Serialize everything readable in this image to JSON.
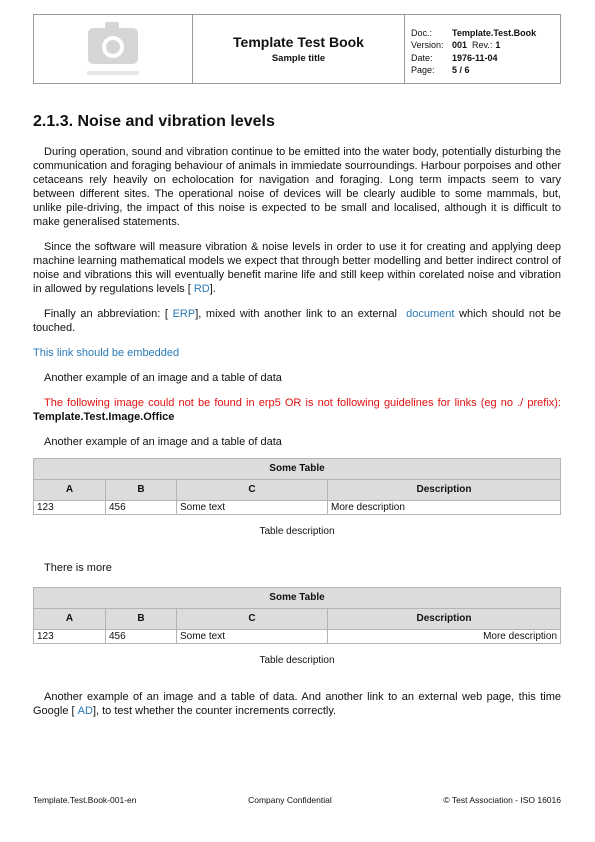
{
  "header": {
    "title": "Template Test Book",
    "subtitle": "Sample title",
    "meta": [
      {
        "key": "Doc.:",
        "value": "Template.Test.Book"
      },
      {
        "key": "Version:",
        "value": "001",
        "extra_key": "Rev.:",
        "extra_value": "1"
      },
      {
        "key": "Date:",
        "value": "1976-11-04"
      },
      {
        "key": "Page:",
        "value": "5 / 6"
      }
    ]
  },
  "heading": "2.1.3. Noise and vibration levels",
  "paragraphs": {
    "p1": "During operation, sound and vibration continue to be emitted into the water body, potentially disturbing the communication and foraging behaviour of animals in immiedate sourroundings. Harbour porpoises and other cetaceans rely heavily on echolocation for navigation and foraging. Long term impacts seem to vary between different sites. The operational noise of devices will be clearly audible to some mammals, but, unlike pile-driving, the impact of this noise is expected to be small and localised, although it is difficult to make generalised statements.",
    "p2": "Since the software will measure vibration & noise levels in order to use it for creating and applying deep machine learning mathematical models we expect that through better modelling and better indirect control of noise and vibrations this will eventually benefit marine life and still keep within corelated noise and vibration in allowed by regulations levels [",
    "p2_link": "RD",
    "p2_end": "].",
    "p3_a": "Finally an abbreviation: [",
    "p3_link1": "ERP",
    "p3_b": "], mixed with another link to an external",
    "p3_link2": "document",
    "p3_c": "which should not be touched.",
    "embedded_link": "This link should be embedded",
    "p4": "Another example of an image and a table of data",
    "error_text": "The following image could not be found in erp5 OR is not following guidelines for links (eg no ./ prefix):",
    "error_ref": "Template.Test.Image.Office",
    "p5": "Another example of an image and a table of data",
    "p6": "There is more",
    "p7_a": "Another example of an image and a table of data. And another link to an external web page, this time Google [",
    "p7_link": "AD",
    "p7_b": "], to test whether the counter increments correctly."
  },
  "table1": {
    "title": "Some Table",
    "columns": [
      "A",
      "B",
      "C",
      "Description"
    ],
    "rows": [
      [
        "123",
        "456",
        "Some text",
        "More description"
      ]
    ],
    "caption": "Table description"
  },
  "table2": {
    "title": "Some Table",
    "columns": [
      "A",
      "B",
      "C",
      "Description"
    ],
    "rows": [
      [
        "123",
        "456",
        "Some text",
        "More description"
      ]
    ],
    "caption": "Table description"
  },
  "footer": {
    "left": "Template.Test.Book-001-en",
    "center": "Company Confidential",
    "right": "© Test Association - ISO 16016"
  }
}
